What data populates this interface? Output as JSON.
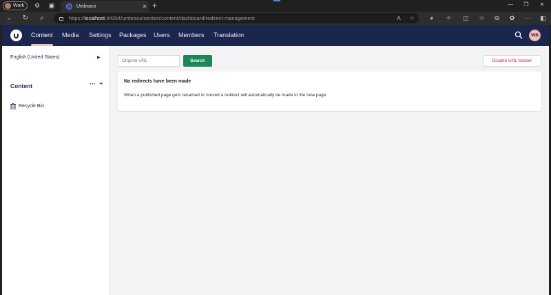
{
  "browser": {
    "profile_label": "Work",
    "tab_title": "Umbraco",
    "url_prefix": "https://",
    "url_host": "localhost",
    "url_rest": ":44354/umbraco/section/content/dashboard/redirect-management"
  },
  "header": {
    "sections": [
      "Content",
      "Media",
      "Settings",
      "Packages",
      "Users",
      "Members",
      "Translation"
    ],
    "active_section": "Content",
    "avatar_initials": "WB"
  },
  "tree": {
    "language": "English (United States)",
    "heading": "Content",
    "recycle_bin": "Recycle Bin"
  },
  "main": {
    "search_placeholder": "Original URL",
    "search_button": "Search",
    "disable_button": "Disable URL tracker",
    "empty_title": "No redirects have been made",
    "empty_text": "When a published page gets renamed or moved a redirect will automatically be made to the new page."
  },
  "colors": {
    "header_bg": "#1b264f",
    "active_indicator": "#f5c1bc",
    "search_button_bg": "#1d8657",
    "danger_text": "#d42054"
  }
}
